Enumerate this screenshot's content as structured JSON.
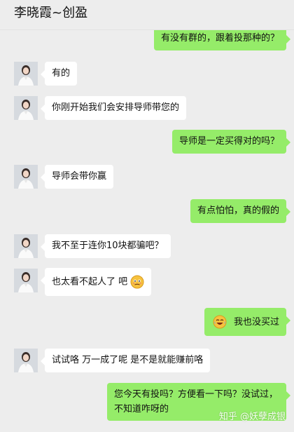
{
  "header": {
    "title": "李晓霞~创盈"
  },
  "messages": [
    {
      "side": "out",
      "text": "有没有群的，跟着投那种的？"
    },
    {
      "side": "in",
      "text": "有的"
    },
    {
      "side": "in",
      "text": "你刚开始我们会安排导师带您的"
    },
    {
      "side": "out",
      "text": "导师是一定买得对的吗？"
    },
    {
      "side": "in",
      "text": "导师会带你赢"
    },
    {
      "side": "out",
      "text": "有点怕怕，真的假的"
    },
    {
      "side": "in",
      "text": "我不至于连你10块都骗吧？"
    },
    {
      "side": "in",
      "text": "也太看不起人了 吧",
      "emoji": "awkward-face-emoji"
    },
    {
      "side": "out",
      "text": "我也没买过",
      "emoji": "laughing-crying-emoji"
    },
    {
      "side": "in",
      "text": "试试咯  万一成了呢  是不是就能赚前咯"
    },
    {
      "side": "out",
      "text": "您今天有投吗？方便看一下吗？没试过，不知道咋呀的"
    }
  ],
  "watermark": "知乎 @妖孽成银",
  "colors": {
    "outgoing_bubble": "#95ec69",
    "incoming_bubble": "#ffffff",
    "background": "#ededed"
  }
}
